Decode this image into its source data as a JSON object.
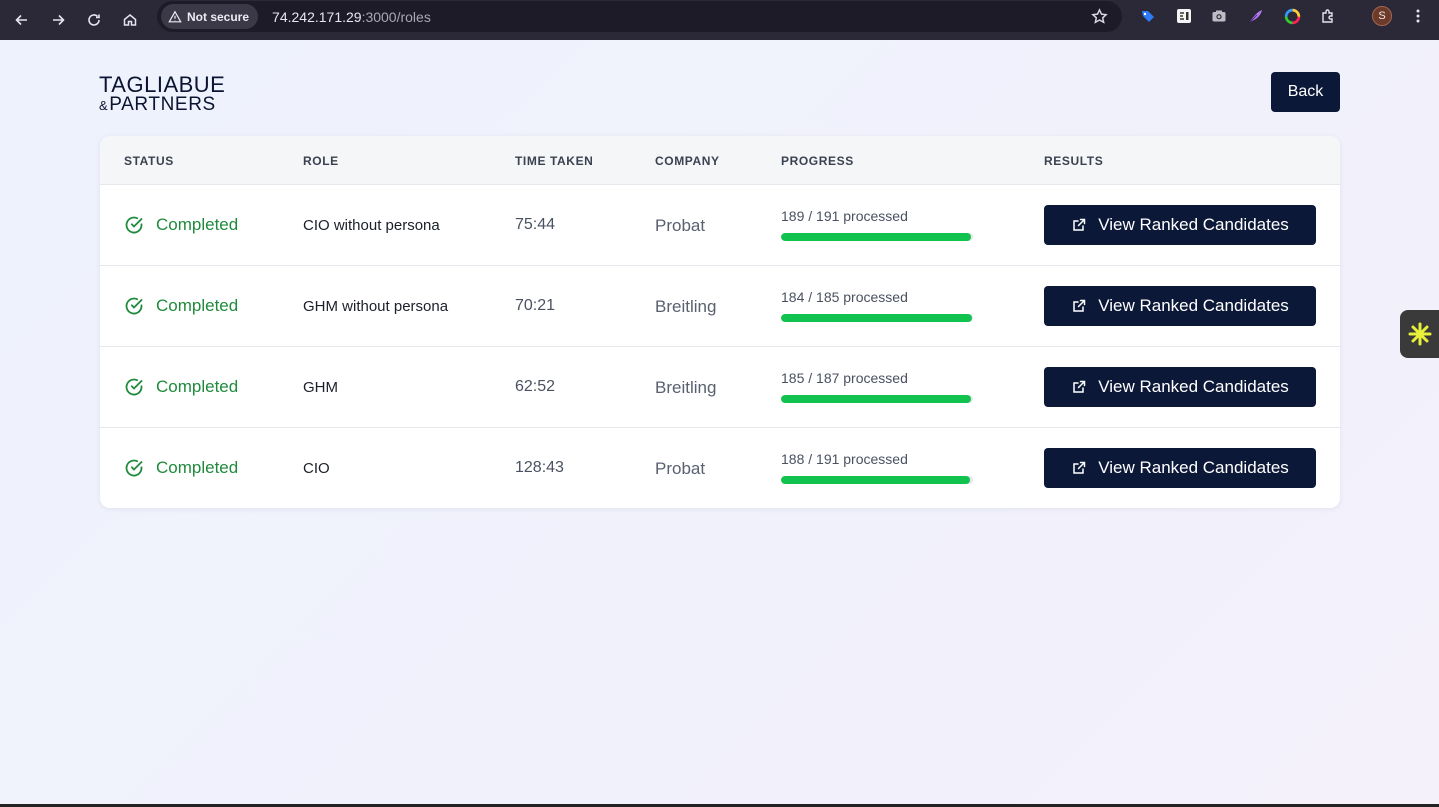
{
  "browser": {
    "security_chip": "Not secure",
    "url_host": "74.242.171.29",
    "url_rest": ":3000/roles",
    "profile_initial": "S"
  },
  "header": {
    "logo_line1": "TAGLIABUE",
    "logo_amp": "&",
    "logo_line2": "PARTNERS",
    "back_label": "Back"
  },
  "table": {
    "headers": [
      "STATUS",
      "ROLE",
      "TIME TAKEN",
      "COMPANY",
      "PROGRESS",
      "RESULTS"
    ],
    "rows": [
      {
        "status": "Completed",
        "role": "CIO without persona",
        "time": "75:44",
        "company": "Probat",
        "progress_text": "189 / 191 processed",
        "progress": 0.9895,
        "button": "View Ranked Candidates"
      },
      {
        "status": "Completed",
        "role": "GHM without persona",
        "time": "70:21",
        "company": "Breitling",
        "progress_text": "184 / 185 processed",
        "progress": 0.9946,
        "button": "View Ranked Candidates"
      },
      {
        "status": "Completed",
        "role": "GHM",
        "time": "62:52",
        "company": "Breitling",
        "progress_text": "185 / 187 processed",
        "progress": 0.9893,
        "button": "View Ranked Candidates"
      },
      {
        "status": "Completed",
        "role": "CIO",
        "time": "128:43",
        "company": "Probat",
        "progress_text": "188 / 191 processed",
        "progress": 0.9843,
        "button": "View Ranked Candidates"
      }
    ]
  },
  "colors": {
    "accent_navy": "#0c1838",
    "status_green": "#1f8a3c",
    "progress_green": "#12c24f"
  }
}
